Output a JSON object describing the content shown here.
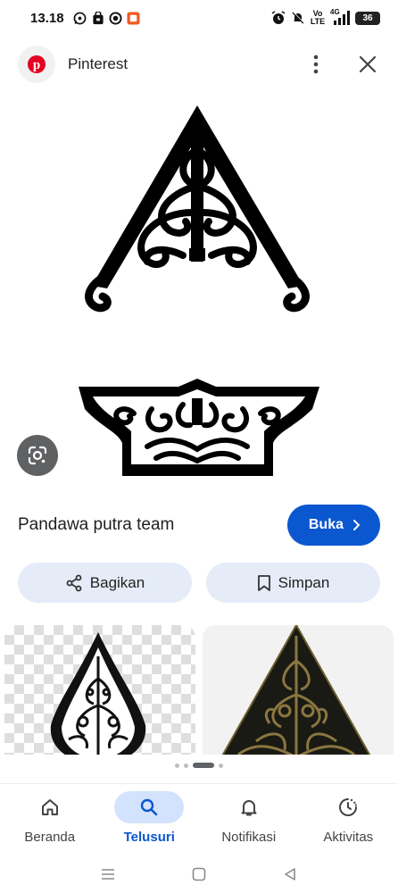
{
  "status_bar": {
    "time": "13.18",
    "left_icons": [
      "whatsapp-icon",
      "shopping-bag-icon",
      "record-icon",
      "app-notification-icon"
    ],
    "right_icons": [
      "alarm-icon",
      "mute-icon",
      "volte-icon",
      "signal-icon"
    ],
    "volte_top": "Vo",
    "volte_bottom": "LTE",
    "network": "4G",
    "battery": "36"
  },
  "app_header": {
    "logo_icon": "pinterest-logo-icon",
    "title": "Pinterest",
    "more_icon": "more-vertical-icon",
    "close_icon": "close-icon"
  },
  "image": {
    "subject": "gunungan-ornament-icon",
    "lens_icon": "google-lens-icon"
  },
  "source": {
    "name": "Pandawa putra team",
    "open_label": "Buka",
    "open_icon": "chevron-right-icon",
    "accent_color": "#0b57d0"
  },
  "actions": {
    "share_label": "Bagikan",
    "save_label": "Simpan"
  },
  "related": [
    {
      "icon": "gunungan-ornament-icon",
      "style": "transparent-background"
    },
    {
      "icon": "golden-gunungan-icon",
      "style": "plain-background"
    }
  ],
  "pager": {
    "dots": 4,
    "active_index": 2
  },
  "bottom_nav": {
    "items": [
      {
        "label": "Beranda",
        "icon": "home-icon",
        "active": false
      },
      {
        "label": "Telusuri",
        "icon": "search-icon",
        "active": true
      },
      {
        "label": "Notifikasi",
        "icon": "bell-icon",
        "active": false
      },
      {
        "label": "Aktivitas",
        "icon": "activity-icon",
        "active": false
      }
    ],
    "active_color": "#0b57d0",
    "active_bg": "#d3e3fd"
  },
  "system_nav": [
    "recents-icon",
    "home-square-icon",
    "back-icon"
  ]
}
